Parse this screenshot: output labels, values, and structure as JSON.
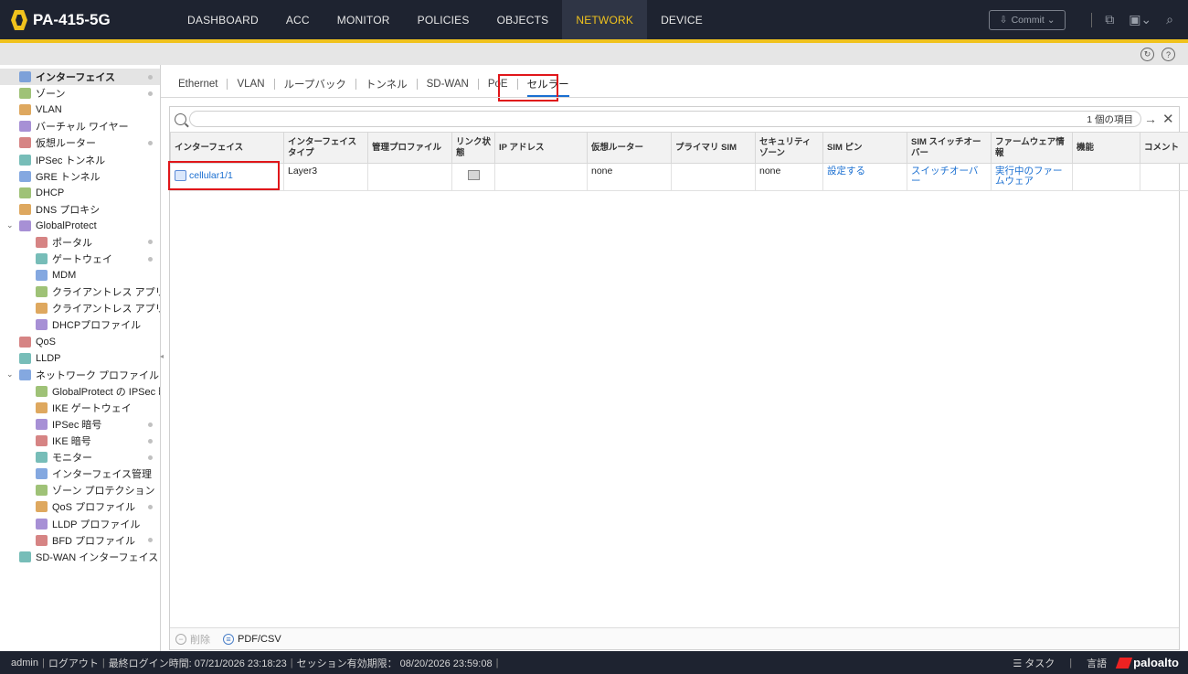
{
  "app": {
    "device_name": "PA-415-5G"
  },
  "topnav": {
    "tabs": [
      {
        "label": "DASHBOARD"
      },
      {
        "label": "ACC"
      },
      {
        "label": "MONITOR"
      },
      {
        "label": "POLICIES"
      },
      {
        "label": "OBJECTS"
      },
      {
        "label": "NETWORK",
        "active": true
      },
      {
        "label": "DEVICE"
      }
    ],
    "commit_label": "Commit"
  },
  "sidebar": {
    "items": [
      {
        "label": "インターフェイス",
        "icon": "interface-icon",
        "active": true,
        "dot": true
      },
      {
        "label": "ゾーン",
        "icon": "zone-icon",
        "dot": true
      },
      {
        "label": "VLAN",
        "icon": "vlan-icon"
      },
      {
        "label": "バーチャル ワイヤー",
        "icon": "virtual-wire-icon"
      },
      {
        "label": "仮想ルーター",
        "icon": "virtual-router-icon",
        "dot": true
      },
      {
        "label": "IPSec トンネル",
        "icon": "ipsec-tunnel-icon"
      },
      {
        "label": "GRE トンネル",
        "icon": "gre-tunnel-icon"
      },
      {
        "label": "DHCP",
        "icon": "dhcp-icon"
      },
      {
        "label": "DNS プロキシ",
        "icon": "dns-proxy-icon"
      },
      {
        "label": "GlobalProtect",
        "icon": "globalprotect-icon",
        "expandable": true
      },
      {
        "label": "ポータル",
        "icon": "portal-icon",
        "indent": true,
        "dot": true
      },
      {
        "label": "ゲートウェイ",
        "icon": "gateway-icon",
        "indent": true,
        "dot": true
      },
      {
        "label": "MDM",
        "icon": "mdm-icon",
        "indent": true
      },
      {
        "label": "クライアントレス アプリケ",
        "icon": "clientless-app-icon",
        "indent": true
      },
      {
        "label": "クライアントレス アプリケ",
        "icon": "clientless-app-group-icon",
        "indent": true
      },
      {
        "label": "DHCPプロファイル",
        "icon": "dhcp-profile-icon",
        "indent": true
      },
      {
        "label": "QoS",
        "icon": "qos-icon"
      },
      {
        "label": "LLDP",
        "icon": "lldp-icon"
      },
      {
        "label": "ネットワーク プロファイル",
        "icon": "network-profiles-icon",
        "expandable": true
      },
      {
        "label": "GlobalProtect の IPSec 暗号",
        "icon": "lock-icon",
        "indent": true
      },
      {
        "label": "IKE ゲートウェイ",
        "icon": "ike-gateway-icon",
        "indent": true
      },
      {
        "label": "IPSec 暗号",
        "icon": "lock-icon",
        "indent": true,
        "dot": true
      },
      {
        "label": "IKE 暗号",
        "icon": "lock-icon",
        "indent": true,
        "dot": true
      },
      {
        "label": "モニター",
        "icon": "monitor-icon",
        "indent": true,
        "dot": true
      },
      {
        "label": "インターフェイス管理",
        "icon": "interface-mgmt-icon",
        "indent": true
      },
      {
        "label": "ゾーン プロテクション",
        "icon": "zone-protection-icon",
        "indent": true
      },
      {
        "label": "QoS プロファイル",
        "icon": "qos-profile-icon",
        "indent": true,
        "dot": true
      },
      {
        "label": "LLDP プロファイル",
        "icon": "lldp-profile-icon",
        "indent": true
      },
      {
        "label": "BFD プロファイル",
        "icon": "bfd-profile-icon",
        "indent": true,
        "dot": true
      },
      {
        "label": "SD-WAN インターフェイス プロ",
        "icon": "sdwan-interface-icon"
      }
    ]
  },
  "subtabs": [
    {
      "label": "Ethernet"
    },
    {
      "label": "VLAN"
    },
    {
      "label": "ループバック"
    },
    {
      "label": "トンネル"
    },
    {
      "label": "SD-WAN"
    },
    {
      "label": "PoE"
    },
    {
      "label": "セルラー",
      "active": true
    }
  ],
  "search": {
    "placeholder": "",
    "count_label": "1 個の項目"
  },
  "table": {
    "columns": [
      {
        "label": "インターフェイス"
      },
      {
        "label": "インターフェイス タイプ"
      },
      {
        "label": "管理プロファイル"
      },
      {
        "label": "リンク状態"
      },
      {
        "label": "IP アドレス"
      },
      {
        "label": "仮想ルーター"
      },
      {
        "label": "プライマリ SIM"
      },
      {
        "label": "セキュリティ ゾーン"
      },
      {
        "label": "SIM ピン"
      },
      {
        "label": "SIM スイッチオーバー"
      },
      {
        "label": "ファームウェア情報"
      },
      {
        "label": "機能"
      },
      {
        "label": "コメント"
      }
    ],
    "rows": [
      {
        "interface": "cellular1/1",
        "type": "Layer3",
        "mgmt_profile": "",
        "ip": "",
        "vrouter": "none",
        "primary_sim": "",
        "zone": "none",
        "sim_pin": "設定する",
        "sim_switchover": "スイッチオーバー",
        "firmware": "実行中のファームウェア",
        "feature": "",
        "comment": ""
      }
    ]
  },
  "footer_actions": {
    "delete_label": "削除",
    "pdf_label": "PDF/CSV"
  },
  "statusbar": {
    "user": "admin",
    "logout": "ログアウト",
    "last_login": "最終ログイン時間: 07/21/2026 23:18:23",
    "session_expiry": "セッション有効期限： 08/20/2026 23:59:08",
    "tasks": "タスク",
    "language": "言語",
    "brand": "paloalto"
  },
  "colors": {
    "nav_bg": "#1e2330",
    "accent_yellow": "#f0c21d",
    "link_blue": "#1a6fd1",
    "highlight_red": "#e0161a"
  }
}
